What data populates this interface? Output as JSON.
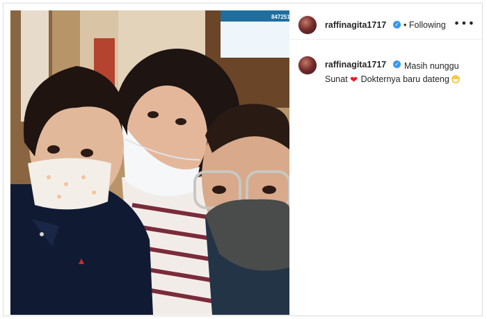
{
  "post": {
    "username": "raffinagita1717",
    "verified_badge": "✓",
    "follow_separator": "•",
    "follow_status": "Following",
    "more_icon": "•••",
    "caption_line1_text": "Masih nunggu",
    "caption_line2_a": "Sunat",
    "caption_heart": "❤",
    "caption_line2_b": "Dokternya baru dateng",
    "caption_emoji": "smiling-face-with-mask-emoji"
  },
  "photo": {
    "screen_text": "847251"
  }
}
